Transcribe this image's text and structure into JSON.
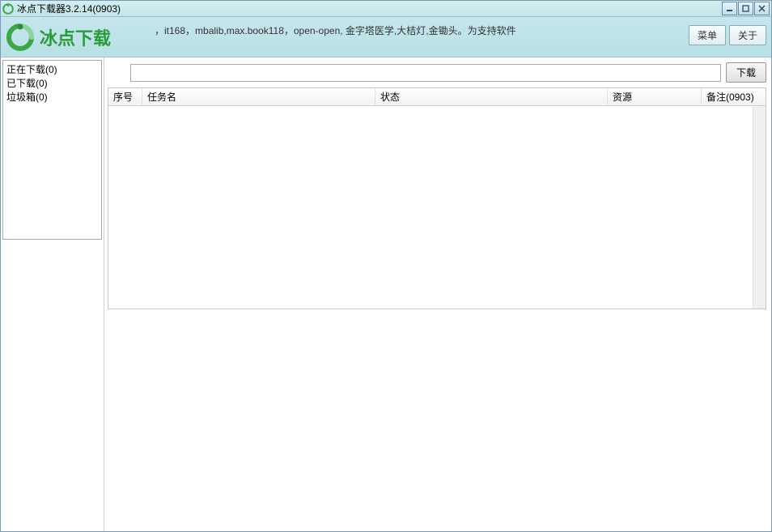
{
  "titlebar": {
    "title": "冰点下载器3.2.14(0903)"
  },
  "header": {
    "logo_text": "冰点下载",
    "info_text": "，it168，mbalib,max.book118，open-open, 金字塔医学,大桔灯,金锄头。为支持软件",
    "menu_button": "菜单",
    "about_button": "关于"
  },
  "sidebar": {
    "items": [
      {
        "label": "正在下载(0)"
      },
      {
        "label": "已下载(0)"
      },
      {
        "label": "垃圾箱(0)"
      }
    ]
  },
  "input_row": {
    "url_value": "",
    "download_button": "下载"
  },
  "table": {
    "columns": {
      "seq": "序号",
      "name": "任务名",
      "status": "状态",
      "resource": "资源",
      "note": "备注(0903)"
    }
  }
}
